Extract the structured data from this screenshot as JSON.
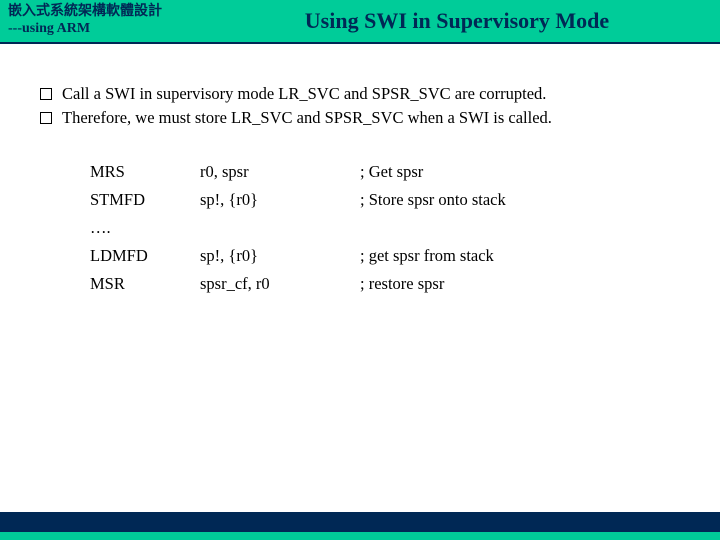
{
  "header": {
    "title_cn": "嵌入式系統架構軟體設計",
    "subtitle": "---using ARM",
    "title_en": "Using SWI in Supervisory Mode"
  },
  "bullets": [
    "Call a SWI in supervisory mode LR_SVC and SPSR_SVC are corrupted.",
    "Therefore, we must store LR_SVC and SPSR_SVC when a SWI is called."
  ],
  "code": [
    {
      "mnemonic": "MRS",
      "operands": "r0, spsr",
      "comment": "; Get spsr"
    },
    {
      "mnemonic": "STMFD",
      "operands": "sp!, {r0}",
      "comment": "; Store spsr onto stack"
    },
    {
      "mnemonic": "….",
      "operands": "",
      "comment": ""
    },
    {
      "mnemonic": "LDMFD",
      "operands": "sp!, {r0}",
      "comment": "; get spsr from stack"
    },
    {
      "mnemonic": "MSR",
      "operands": "spsr_cf, r0",
      "comment": "; restore spsr"
    }
  ]
}
